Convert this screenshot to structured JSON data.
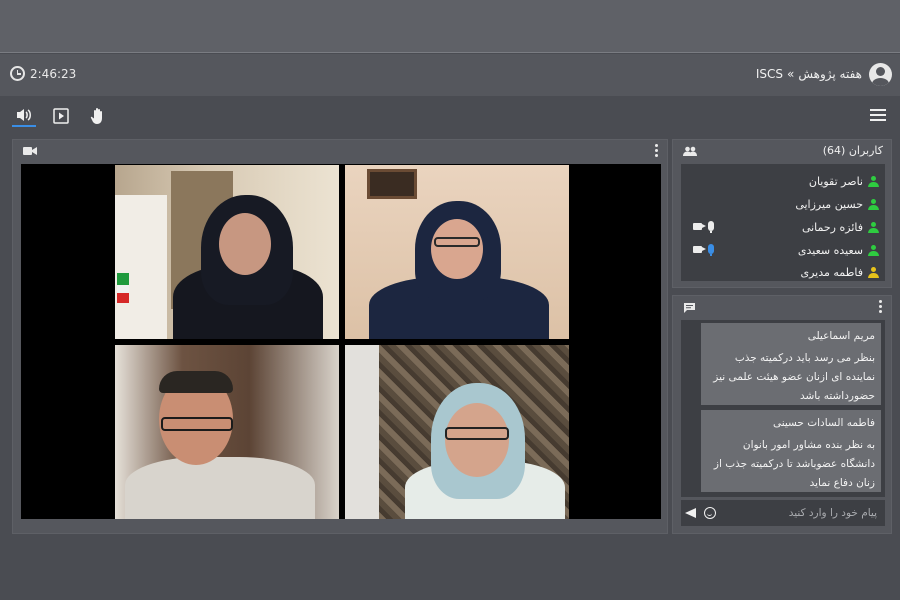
{
  "header": {
    "timer": "2:46:23",
    "breadcrumb_root": "ISCS",
    "breadcrumb_sep": "»",
    "breadcrumb_page": "هفته پژوهش"
  },
  "toolbar": {
    "icons": [
      "speaker-icon",
      "play-icon",
      "raise-hand-icon",
      "menu-icon"
    ]
  },
  "video": {
    "panel_icon": "video-camera-icon",
    "tiles": [
      "participant-1",
      "participant-2",
      "participant-3",
      "participant-4"
    ]
  },
  "users": {
    "title": "کاربران (64)",
    "list": [
      {
        "name": "ناصر تقویان",
        "status": "green",
        "mic": "",
        "cam": ""
      },
      {
        "name": "حسین میرزایی",
        "status": "green",
        "mic": "",
        "cam": ""
      },
      {
        "name": "فائزه رحمانی",
        "status": "green",
        "mic": "white",
        "cam": "on"
      },
      {
        "name": "سعیده سعیدی",
        "status": "green",
        "mic": "blue",
        "cam": "on"
      },
      {
        "name": "فاطمه مدیری",
        "status": "yellow",
        "mic": "",
        "cam": ""
      }
    ]
  },
  "chat": {
    "messages": [
      {
        "sender": "مریم اسماعیلی",
        "text": "بنظر می رسد باید درکمیته جذب نماینده ای ازنان عضو هیئت علمی  نیز حضورداشته باشد"
      },
      {
        "sender": "فاطمه السادات حسینی",
        "text": "به نظر بنده مشاور امور بانوان دانشگاه عضوباشد تا درکمیته جذب از زنان دفاع نماید"
      }
    ],
    "input_placeholder": "پیام خود را وارد کنید"
  },
  "colors": {
    "accent": "#3a8ee6",
    "online": "#2ecc40",
    "away": "#e7c21b"
  }
}
